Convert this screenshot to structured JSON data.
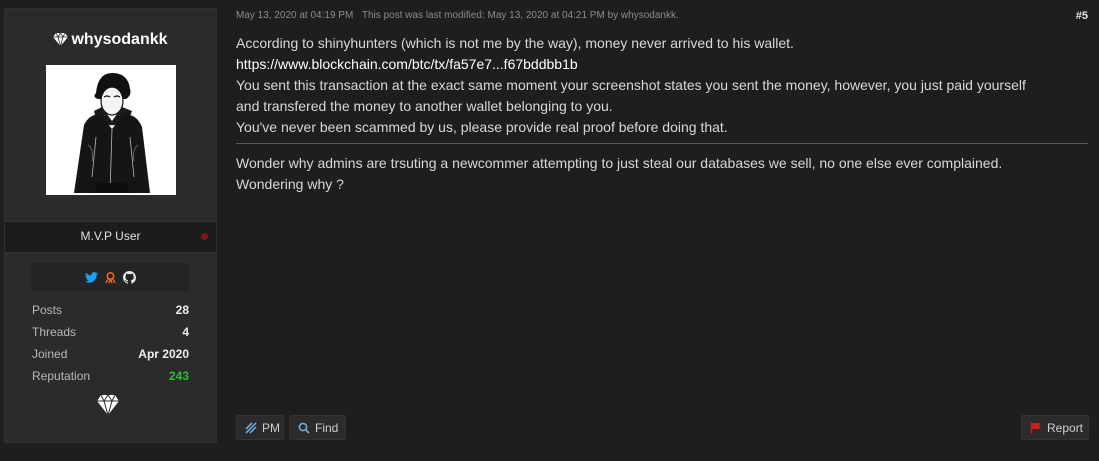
{
  "user": {
    "username": "whysodankk",
    "rank": "M.V.P User",
    "social_icons": [
      "twitter-icon",
      "keybase-icon",
      "github-icon"
    ],
    "stats": [
      {
        "label": "Posts",
        "value": "28"
      },
      {
        "label": "Threads",
        "value": "4"
      },
      {
        "label": "Joined",
        "value": "Apr 2020"
      },
      {
        "label": "Reputation",
        "value": "243"
      }
    ],
    "colors": {
      "reputation": "#2fbf2f",
      "status": "#7a1818",
      "twitter": "#1da1f2",
      "keybase": "#ff6f21"
    }
  },
  "post": {
    "date": "May 13, 2020 at 04:19 PM",
    "modified": "This post was last modified: May 13, 2020 at 04:21 PM by whysodankk.",
    "number": "#5",
    "line1": "According to shinyhunters (which is not me by the way), money never arrived to his wallet.",
    "link": "https://www.blockchain.com/btc/tx/fa57e7...f67bddbb1b",
    "line3": "You sent this transaction at the exact same moment your screenshot states you sent the money, however, you just paid yourself",
    "line4": "and transfered the money to another wallet belonging to you.",
    "line5": "You've never been scammed by us, please provide real proof before doing that.",
    "signature1": "Wonder why admins are trsuting a newcommer attempting to just steal our databases we sell, no one else ever complained.",
    "signature2": "Wondering why ?"
  },
  "actions": {
    "pm_label": "PM",
    "find_label": "Find",
    "report_label": "Report"
  }
}
